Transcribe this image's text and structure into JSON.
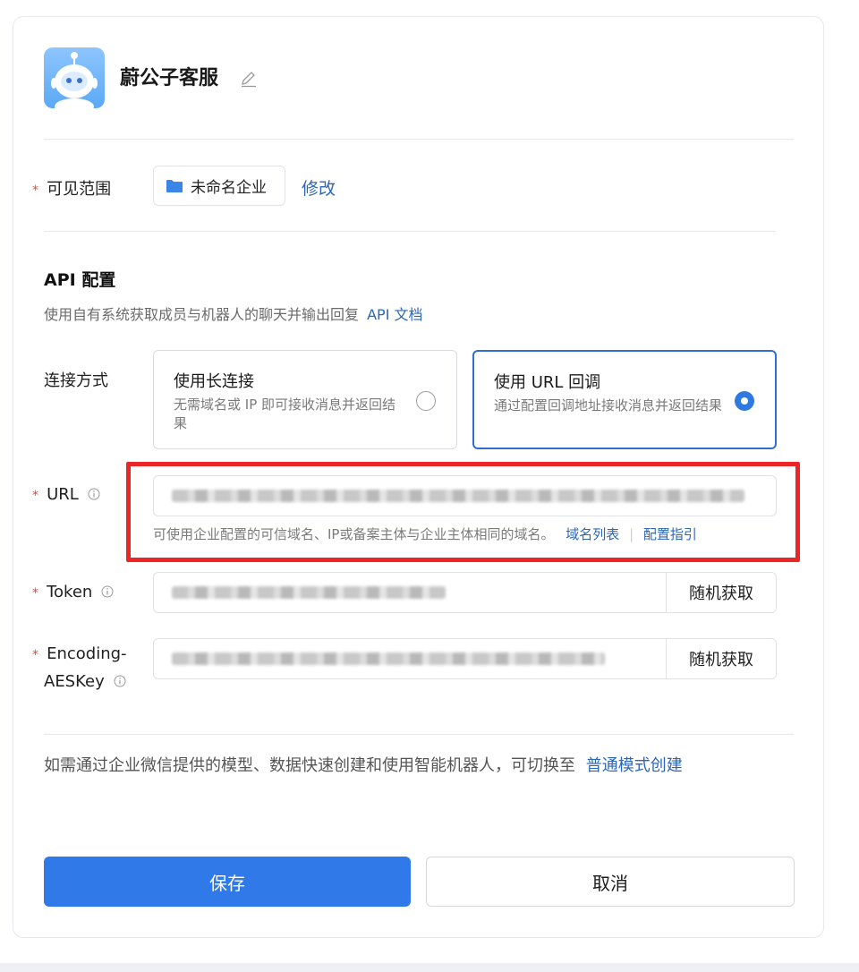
{
  "bot": {
    "name": "蔚公子客服"
  },
  "scope": {
    "label": "可见范围",
    "value": "未命名企业",
    "modify_label": "修改"
  },
  "api": {
    "title": "API 配置",
    "description": "使用自有系统获取成员与机器人的聊天并输出回复",
    "doc_link": "API 文档"
  },
  "connection": {
    "label": "连接方式",
    "options": [
      {
        "title": "使用长连接",
        "desc": "无需域名或 IP 即可接收消息并返回结果",
        "selected": false
      },
      {
        "title": "使用 URL 回调",
        "desc": "通过配置回调地址接收消息并返回结果",
        "selected": true
      }
    ]
  },
  "url": {
    "label": "URL",
    "hint": "可使用企业配置的可信域名、IP或备案主体与企业主体相同的域名。",
    "link_domains": "域名列表",
    "link_guide": "配置指引"
  },
  "token": {
    "label": "Token",
    "random_button": "随机获取"
  },
  "aeskey": {
    "label_line1": "Encoding-",
    "label_line2": "AESKey",
    "random_button": "随机获取"
  },
  "switch_mode": {
    "text": "如需通过企业微信提供的模型、数据快速创建和使用智能机器人，可切换至",
    "link": "普通模式创建"
  },
  "actions": {
    "save": "保存",
    "cancel": "取消"
  },
  "colors": {
    "accent": "#2f7ae8",
    "link": "#2b66b8",
    "required": "#e5473d",
    "highlight_box": "#ec2626"
  }
}
